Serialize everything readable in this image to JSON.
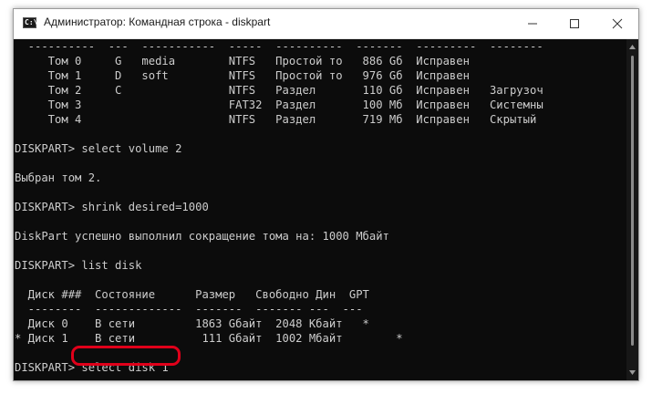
{
  "window": {
    "title": "Администратор: Командная строка - diskpart",
    "icon_label": "C:\\",
    "controls": [
      "minimize",
      "maximize",
      "close"
    ]
  },
  "console": {
    "lines": [
      "  ----------  ---  -----------  -----  ----------  -------  ---------  --------",
      "     Том 0     G   media        NTFS   Простой то   886 Gб  Исправен",
      "     Том 1     D   soft         NTFS   Простой то   976 Gб  Исправен",
      "     Том 2     C                NTFS   Раздел       110 Gб  Исправен   Загрузоч",
      "     Том 3                      FAT32  Раздел       100 Mб  Исправен   Системны",
      "     Том 4                      NTFS   Раздел       719 Mб  Исправен   Скрытый",
      "",
      "DISKPART> select volume 2",
      "",
      "Выбран том 2.",
      "",
      "DISKPART> shrink desired=1000",
      "",
      "DiskPart успешно выполнил сокращение тома на: 1000 Мбайт",
      "",
      "DISKPART> list disk",
      "",
      "  Диск ###  Состояние      Размер   Свободно Дин  GPT",
      "  --------  -------------  -------  ------- ---  ---",
      "  Диск 0    В сети         1863 Gбайт  2048 Kбайт   *",
      "* Диск 1    В сети          111 Gбайт  1002 Mбайт        *",
      "",
      "DISKPART> select disk 1"
    ]
  },
  "highlight": {
    "target_text": "select disk 1",
    "color": "#e0001a"
  },
  "colors": {
    "console_bg": "#0c0c0c",
    "console_fg": "#cccccc",
    "titlebar_bg": "#ffffff"
  }
}
